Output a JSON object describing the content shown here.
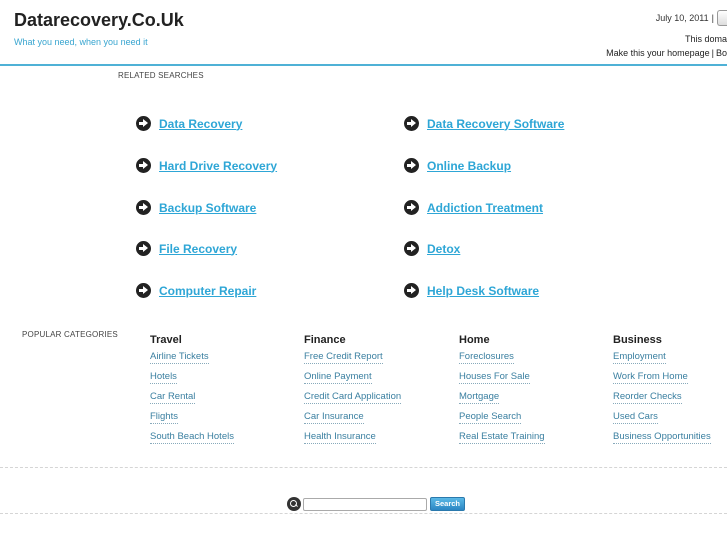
{
  "header": {
    "site_title": "Datarecovery.Co.Uk",
    "tagline": "What you need, when you need it",
    "date": "July 10, 2011",
    "date_separator": "|",
    "domain_notice": "This doma",
    "homepage_link": "Make this your homepage",
    "homepage_separator": "|",
    "bookmark_partial": "Bo"
  },
  "related": {
    "label": "RELATED SEARCHES",
    "left": [
      "Data Recovery",
      "Hard Drive Recovery",
      "Backup Software",
      "File Recovery",
      "Computer Repair"
    ],
    "right": [
      "Data Recovery Software",
      "Online Backup",
      "Addiction Treatment",
      "Detox",
      "Help Desk Software"
    ]
  },
  "popular": {
    "label": "POPULAR CATEGORIES",
    "categories": [
      {
        "title": "Travel",
        "items": [
          "Airline Tickets",
          "Hotels",
          "Car Rental",
          "Flights",
          "South Beach Hotels"
        ]
      },
      {
        "title": "Finance",
        "items": [
          "Free Credit Report",
          "Online Payment",
          "Credit Card Application",
          "Car Insurance",
          "Health Insurance"
        ]
      },
      {
        "title": "Home",
        "items": [
          "Foreclosures",
          "Houses For Sale",
          "Mortgage",
          "People Search",
          "Real Estate Training"
        ]
      },
      {
        "title": "Business",
        "items": [
          "Employment",
          "Work From Home",
          "Reorder Checks",
          "Used Cars",
          "Business Opportunities"
        ]
      }
    ]
  },
  "search": {
    "value": "",
    "button_label": "Search"
  },
  "colors": {
    "accent": "#2ea6d6",
    "header_rule": "#4fb1d6"
  }
}
